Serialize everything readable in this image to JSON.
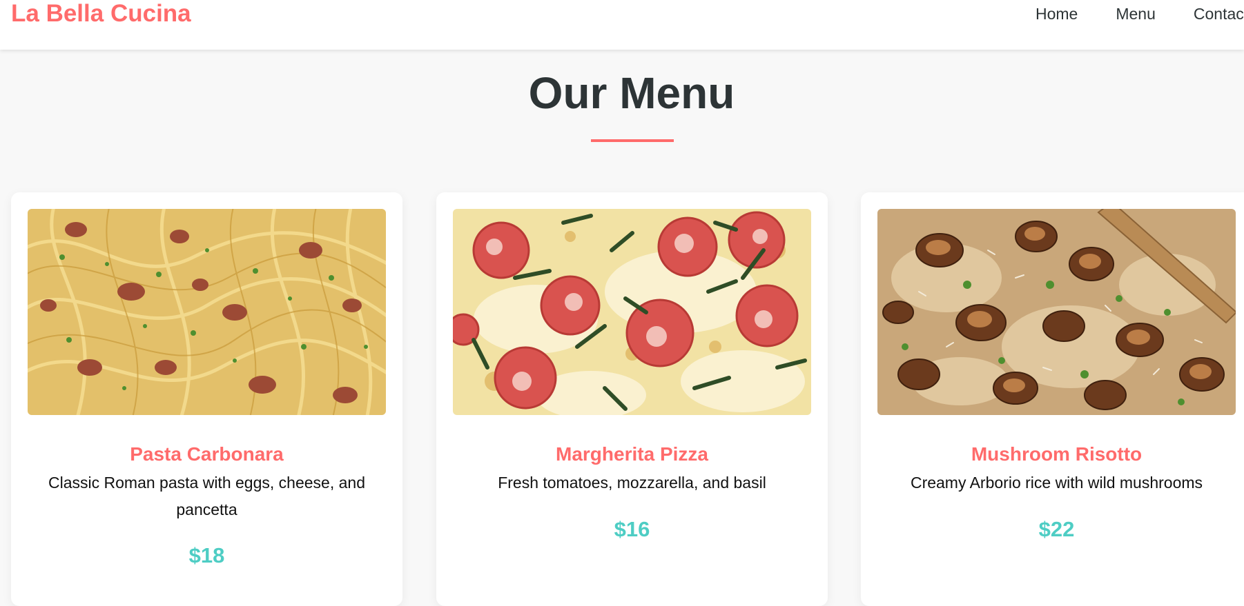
{
  "nav": {
    "logo": "La Bella Cucina",
    "links": [
      {
        "label": "Home"
      },
      {
        "label": "Menu"
      },
      {
        "label": "Contac"
      }
    ]
  },
  "menu": {
    "title": "Our Menu",
    "items": [
      {
        "name": "Pasta Carbonara",
        "description": "Classic Roman pasta with eggs, cheese, and pancetta",
        "price": "$18",
        "image": "pasta-carbonara-photo"
      },
      {
        "name": "Margherita Pizza",
        "description": "Fresh tomatoes, mozzarella, and basil",
        "price": "$16",
        "image": "margherita-pizza-photo"
      },
      {
        "name": "Mushroom Risotto",
        "description": "Creamy Arborio rice with wild mushrooms",
        "price": "$22",
        "image": "mushroom-risotto-photo"
      }
    ]
  },
  "colors": {
    "accent": "#ff6b6b",
    "price": "#4ecdc4",
    "heading": "#2d3436",
    "background": "#f8f8f8"
  }
}
